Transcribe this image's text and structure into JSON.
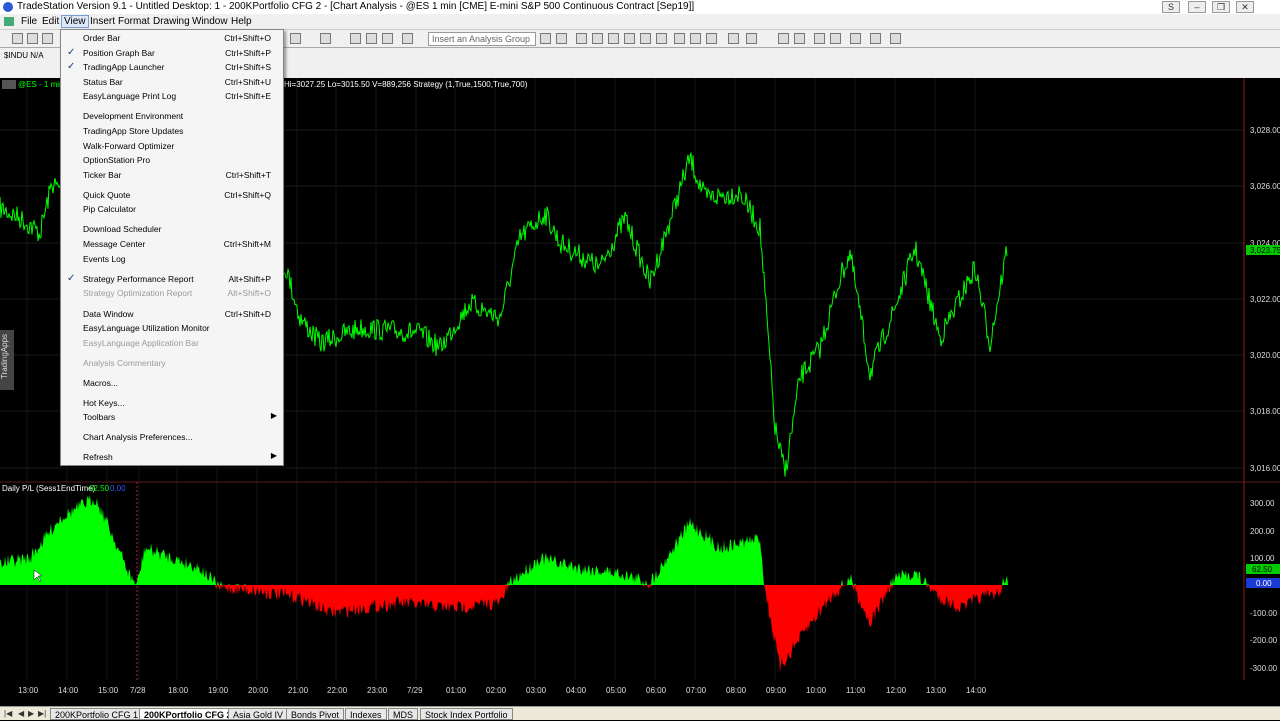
{
  "window": {
    "title": "TradeStation Version 9.1 - Untitled Desktop: 1 - 200KPortfolio CFG 2 - [Chart Analysis - @ES 1 min [CME] E-mini S&P 500 Continuous Contract [Sep19]]",
    "controls": {
      "user": "S",
      "minimize": "–",
      "restore": "❐",
      "close": "✕"
    }
  },
  "menubar": {
    "items": [
      "File",
      "Edit",
      "View",
      "Insert",
      "Format",
      "Drawing",
      "Window",
      "Help"
    ],
    "active": "View"
  },
  "toolbar": {
    "analysis_group_placeholder": "Insert an Analysis Group"
  },
  "subbar": {
    "symbol": "$INDU N/A"
  },
  "chart": {
    "header": {
      "symbol": "@ES - 1 min",
      "stats": "Hi=3027.25  Lo=3015.50  V=889,256  Strategy (1,True,1500,True,700)"
    },
    "price_axis": [
      "3,028.00",
      "3,026.00",
      "3,024.00",
      "3,022.00",
      "3,020.00",
      "3,018.00",
      "3,016.00"
    ],
    "last_price_tag": "3,023.75",
    "indicator": {
      "title": "Daily P/L (Sess1EndTime)",
      "value_1": "62.50",
      "value_2": "0.00",
      "axis": [
        "300.00",
        "200.00",
        "100.00",
        "-100.00",
        "-200.00",
        "-300.00"
      ],
      "value_tag": "62.50",
      "zero_tag": "0.00"
    },
    "time_axis": [
      "13:00",
      "14:00",
      "15:00",
      "7/28",
      "18:00",
      "19:00",
      "20:00",
      "21:00",
      "22:00",
      "23:00",
      "7/29",
      "01:00",
      "02:00",
      "03:00",
      "04:00",
      "05:00",
      "06:00",
      "07:00",
      "08:00",
      "09:00",
      "10:00",
      "11:00",
      "12:00",
      "13:00",
      "14:00"
    ],
    "colors": {
      "price": "#00ff00",
      "profit": "#00ff00",
      "loss": "#ff0000",
      "background": "#000000",
      "grid": "#1a1a1a"
    }
  },
  "side_panel": {
    "label": "TradingApps"
  },
  "view_menu": {
    "items": [
      {
        "label": "Order Bar",
        "shortcut": "Ctrl+Shift+O",
        "checked": false,
        "disabled": false
      },
      {
        "label": "Position Graph Bar",
        "shortcut": "Ctrl+Shift+P",
        "checked": true,
        "disabled": false
      },
      {
        "label": "TradingApp Launcher",
        "shortcut": "Ctrl+Shift+S",
        "checked": true,
        "disabled": false
      },
      {
        "label": "Status Bar",
        "shortcut": "Ctrl+Shift+U",
        "checked": false,
        "disabled": false
      },
      {
        "label": "EasyLanguage Print Log",
        "shortcut": "Ctrl+Shift+E",
        "checked": false,
        "disabled": false
      },
      {
        "label": "Development Environment",
        "shortcut": "",
        "checked": false,
        "disabled": false
      },
      {
        "label": "TradingApp Store Updates",
        "shortcut": "",
        "checked": false,
        "disabled": false
      },
      {
        "label": "Walk-Forward Optimizer",
        "shortcut": "",
        "checked": false,
        "disabled": false
      },
      {
        "label": "OptionStation Pro",
        "shortcut": "",
        "checked": false,
        "disabled": false
      },
      {
        "label": "Ticker Bar",
        "shortcut": "Ctrl+Shift+T",
        "checked": false,
        "disabled": false
      },
      {
        "label": "Quick Quote",
        "shortcut": "Ctrl+Shift+Q",
        "checked": false,
        "disabled": false
      },
      {
        "label": "Pip Calculator",
        "shortcut": "",
        "checked": false,
        "disabled": false
      },
      {
        "label": "Download Scheduler",
        "shortcut": "",
        "checked": false,
        "disabled": false
      },
      {
        "label": "Message Center",
        "shortcut": "Ctrl+Shift+M",
        "checked": false,
        "disabled": false
      },
      {
        "label": "Events Log",
        "shortcut": "",
        "checked": false,
        "disabled": false
      },
      {
        "label": "Strategy Performance Report",
        "shortcut": "Alt+Shift+P",
        "checked": true,
        "disabled": false
      },
      {
        "label": "Strategy Optimization Report",
        "shortcut": "Alt+Shift+O",
        "checked": false,
        "disabled": true
      },
      {
        "label": "Data Window",
        "shortcut": "Ctrl+Shift+D",
        "checked": false,
        "disabled": false
      },
      {
        "label": "EasyLanguage Utilization Monitor",
        "shortcut": "",
        "checked": false,
        "disabled": false
      },
      {
        "label": "EasyLanguage Application Bar",
        "shortcut": "",
        "checked": false,
        "disabled": true
      },
      {
        "label": "Analysis Commentary",
        "shortcut": "",
        "checked": false,
        "disabled": true
      },
      {
        "label": "Macros...",
        "shortcut": "",
        "checked": false,
        "disabled": false
      },
      {
        "label": "Hot Keys...",
        "shortcut": "",
        "checked": false,
        "disabled": false
      },
      {
        "label": "Toolbars",
        "shortcut": "",
        "checked": false,
        "disabled": false,
        "submenu": true
      },
      {
        "label": "Chart Analysis Preferences...",
        "shortcut": "",
        "checked": false,
        "disabled": false
      },
      {
        "label": "Refresh",
        "shortcut": "",
        "checked": false,
        "disabled": false,
        "submenu": true
      }
    ]
  },
  "workspace_tabs": {
    "tabs": [
      "200KPortfolio CFG 1",
      "200KPortfolio CFG 2",
      "Asia Gold IV",
      "Bonds Pivot",
      "Indexes",
      "MDS",
      "Stock Index Portfolio"
    ],
    "active": "200KPortfolio CFG 2"
  }
}
